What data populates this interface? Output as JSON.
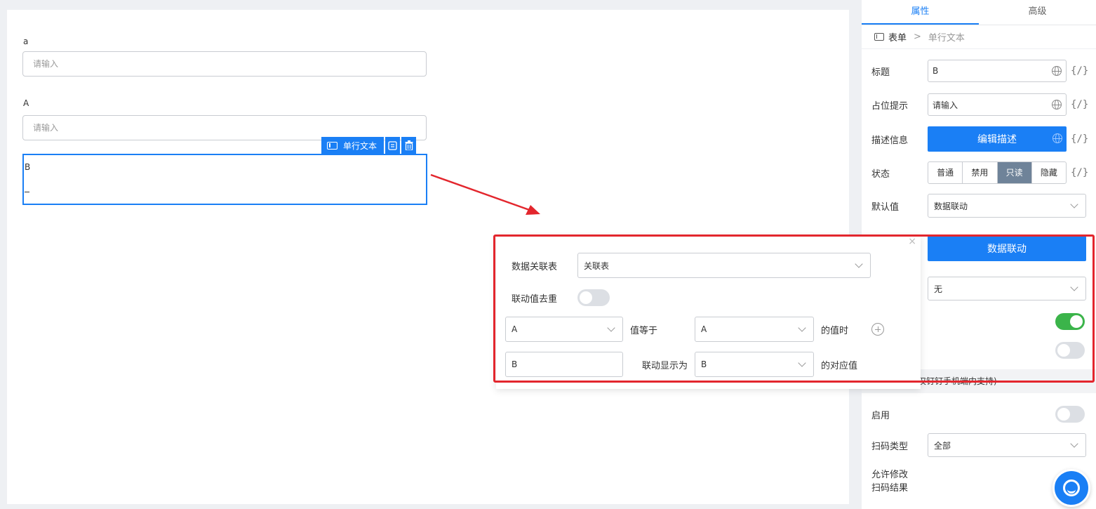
{
  "canvas": {
    "field_a": {
      "label": "a",
      "placeholder": "请输入"
    },
    "field_A": {
      "label": "A",
      "placeholder": "请输入"
    },
    "field_B": {
      "label": "B"
    },
    "toolbar": {
      "type_label": "单行文本"
    }
  },
  "panel": {
    "tabs": [
      {
        "label": "属性",
        "active": true
      },
      {
        "label": "高级",
        "active": false
      }
    ],
    "breadcrumb": {
      "root": "表单",
      "separator": ">",
      "current": "单行文本"
    },
    "title": {
      "label": "标题",
      "value": "B"
    },
    "placeholder": {
      "label": "占位提示",
      "value": "请输入"
    },
    "description": {
      "label": "描述信息",
      "button": "编辑描述"
    },
    "status": {
      "label": "状态",
      "options": [
        "普通",
        "禁用",
        "只读",
        "隐藏"
      ],
      "selected": "只读"
    },
    "default_value": {
      "label": "默认值",
      "value": "数据联动"
    },
    "linkage_button": "数据联动",
    "hidden_select_value": "无",
    "toggle_1_on": true,
    "toggle_2_on": false,
    "section_bar": "仅钉钉手机端内支持)",
    "enable": {
      "label": "启用",
      "on": false
    },
    "scan_type": {
      "label": "扫码类型",
      "value": "全部"
    },
    "allow_modify": {
      "label_line1": "允许修改",
      "label_line2": "扫码结果"
    },
    "braces": "{/}"
  },
  "popover": {
    "related_table_label": "数据关联表",
    "related_table_value": "关联表",
    "dedupe_label": "联动值去重",
    "dedupe_on": false,
    "condition": {
      "field": "A",
      "op": "值等于",
      "target": "A",
      "suffix": "的值时"
    },
    "display": {
      "field": "B",
      "op": "联动显示为",
      "target": "B",
      "suffix": "的对应值"
    },
    "close": "×"
  },
  "colors": {
    "primary": "#1a7ff5",
    "highlight": "#e3262d",
    "toggle_on": "#3bb44a"
  }
}
